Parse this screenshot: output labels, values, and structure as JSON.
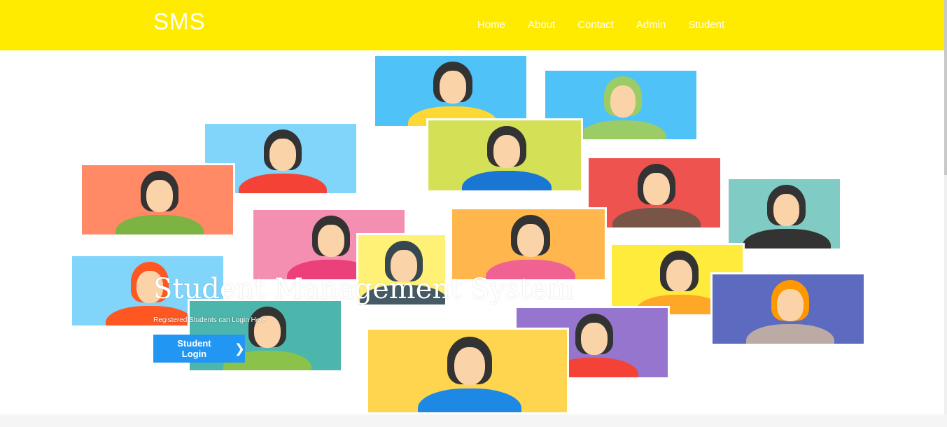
{
  "nav": {
    "brand": "SMS",
    "items": [
      "Home",
      "About",
      "Contact",
      "Admin",
      "Student"
    ]
  },
  "hero": {
    "title": "Student Management System",
    "subtitle": "Registered Students can Login Here",
    "button_label": "Student Login",
    "button_icon": "chevron-right-icon"
  },
  "colors": {
    "nav_bg": "#ffeb00",
    "button": "#2196f3"
  }
}
